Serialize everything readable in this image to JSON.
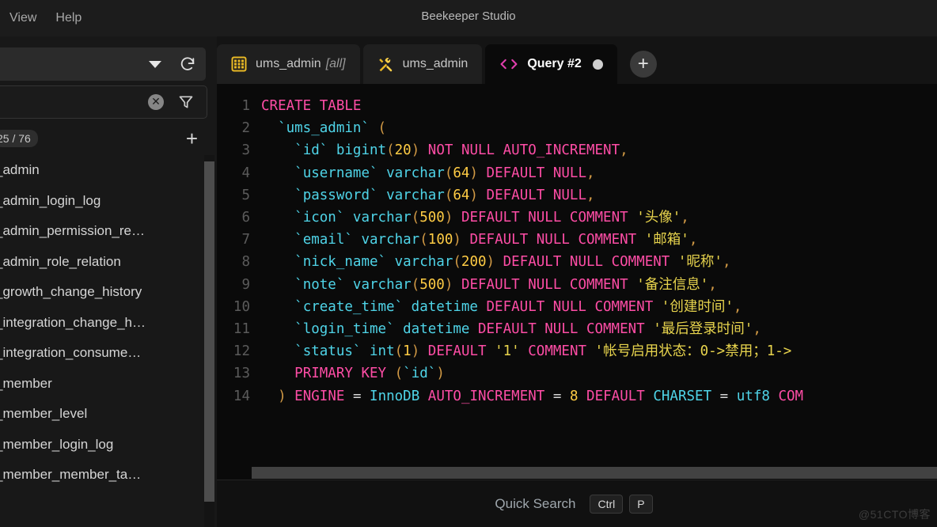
{
  "window": {
    "title": "Beekeeper Studio",
    "menus": [
      {
        "label": "View"
      },
      {
        "label": "Help"
      }
    ]
  },
  "sidebar": {
    "connection_dropdown": {
      "value": "",
      "caret_icon": "chevron-down-icon",
      "refresh_icon": "refresh-icon"
    },
    "filter_input": {
      "value": "",
      "placeholder": "",
      "clear_icon": "clear-circle-icon",
      "filter_icon": "funnel-icon"
    },
    "tables_count": "25 / 76",
    "add_label": "+",
    "tables": [
      {
        "label": "_admin"
      },
      {
        "label": "_admin_login_log"
      },
      {
        "label": "_admin_permission_re…"
      },
      {
        "label": "_admin_role_relation"
      },
      {
        "label": "_growth_change_history"
      },
      {
        "label": "_integration_change_h…"
      },
      {
        "label": "_integration_consume…"
      },
      {
        "label": "_member"
      },
      {
        "label": "_member_level"
      },
      {
        "label": "_member_login_log"
      },
      {
        "label": "_member_member_ta…"
      }
    ]
  },
  "tabs": [
    {
      "label": "ums_admin",
      "suffix": "[all]",
      "icon": "table-grid-icon",
      "active": false,
      "unsaved": false
    },
    {
      "label": "ums_admin",
      "suffix": "",
      "icon": "hammer-wrench-icon",
      "active": false,
      "unsaved": false
    },
    {
      "label": "Query #2",
      "suffix": "",
      "icon": "code-brackets-icon",
      "active": true,
      "unsaved": true
    }
  ],
  "add_tab_label": "+",
  "editor": {
    "lines": [
      {
        "n": "1",
        "tokens": [
          {
            "t": "CREATE TABLE",
            "c": "kw"
          }
        ]
      },
      {
        "n": "2",
        "tokens": [
          {
            "t": "  ",
            "c": "op"
          },
          {
            "t": "`ums_admin`",
            "c": "id"
          },
          {
            "t": " ",
            "c": "op"
          },
          {
            "t": "(",
            "c": "punc"
          }
        ]
      },
      {
        "n": "3",
        "tokens": [
          {
            "t": "    ",
            "c": "op"
          },
          {
            "t": "`id`",
            "c": "id"
          },
          {
            "t": " ",
            "c": "op"
          },
          {
            "t": "bigint",
            "c": "id"
          },
          {
            "t": "(",
            "c": "punc"
          },
          {
            "t": "20",
            "c": "num"
          },
          {
            "t": ")",
            "c": "punc"
          },
          {
            "t": " ",
            "c": "op"
          },
          {
            "t": "NOT NULL AUTO_INCREMENT",
            "c": "kw"
          },
          {
            "t": ",",
            "c": "punc"
          }
        ]
      },
      {
        "n": "4",
        "tokens": [
          {
            "t": "    ",
            "c": "op"
          },
          {
            "t": "`username`",
            "c": "id"
          },
          {
            "t": " ",
            "c": "op"
          },
          {
            "t": "varchar",
            "c": "id"
          },
          {
            "t": "(",
            "c": "punc"
          },
          {
            "t": "64",
            "c": "num"
          },
          {
            "t": ")",
            "c": "punc"
          },
          {
            "t": " ",
            "c": "op"
          },
          {
            "t": "DEFAULT NULL",
            "c": "kw"
          },
          {
            "t": ",",
            "c": "punc"
          }
        ]
      },
      {
        "n": "5",
        "tokens": [
          {
            "t": "    ",
            "c": "op"
          },
          {
            "t": "`password`",
            "c": "id"
          },
          {
            "t": " ",
            "c": "op"
          },
          {
            "t": "varchar",
            "c": "id"
          },
          {
            "t": "(",
            "c": "punc"
          },
          {
            "t": "64",
            "c": "num"
          },
          {
            "t": ")",
            "c": "punc"
          },
          {
            "t": " ",
            "c": "op"
          },
          {
            "t": "DEFAULT NULL",
            "c": "kw"
          },
          {
            "t": ",",
            "c": "punc"
          }
        ]
      },
      {
        "n": "6",
        "tokens": [
          {
            "t": "    ",
            "c": "op"
          },
          {
            "t": "`icon`",
            "c": "id"
          },
          {
            "t": " ",
            "c": "op"
          },
          {
            "t": "varchar",
            "c": "id"
          },
          {
            "t": "(",
            "c": "punc"
          },
          {
            "t": "500",
            "c": "num"
          },
          {
            "t": ")",
            "c": "punc"
          },
          {
            "t": " ",
            "c": "op"
          },
          {
            "t": "DEFAULT NULL COMMENT",
            "c": "kw"
          },
          {
            "t": " ",
            "c": "op"
          },
          {
            "t": "'头像'",
            "c": "str"
          },
          {
            "t": ",",
            "c": "punc"
          }
        ]
      },
      {
        "n": "7",
        "tokens": [
          {
            "t": "    ",
            "c": "op"
          },
          {
            "t": "`email`",
            "c": "id"
          },
          {
            "t": " ",
            "c": "op"
          },
          {
            "t": "varchar",
            "c": "id"
          },
          {
            "t": "(",
            "c": "punc"
          },
          {
            "t": "100",
            "c": "num"
          },
          {
            "t": ")",
            "c": "punc"
          },
          {
            "t": " ",
            "c": "op"
          },
          {
            "t": "DEFAULT NULL COMMENT",
            "c": "kw"
          },
          {
            "t": " ",
            "c": "op"
          },
          {
            "t": "'邮箱'",
            "c": "str"
          },
          {
            "t": ",",
            "c": "punc"
          }
        ]
      },
      {
        "n": "8",
        "tokens": [
          {
            "t": "    ",
            "c": "op"
          },
          {
            "t": "`nick_name`",
            "c": "id"
          },
          {
            "t": " ",
            "c": "op"
          },
          {
            "t": "varchar",
            "c": "id"
          },
          {
            "t": "(",
            "c": "punc"
          },
          {
            "t": "200",
            "c": "num"
          },
          {
            "t": ")",
            "c": "punc"
          },
          {
            "t": " ",
            "c": "op"
          },
          {
            "t": "DEFAULT NULL COMMENT",
            "c": "kw"
          },
          {
            "t": " ",
            "c": "op"
          },
          {
            "t": "'昵称'",
            "c": "str"
          },
          {
            "t": ",",
            "c": "punc"
          }
        ]
      },
      {
        "n": "9",
        "tokens": [
          {
            "t": "    ",
            "c": "op"
          },
          {
            "t": "`note`",
            "c": "id"
          },
          {
            "t": " ",
            "c": "op"
          },
          {
            "t": "varchar",
            "c": "id"
          },
          {
            "t": "(",
            "c": "punc"
          },
          {
            "t": "500",
            "c": "num"
          },
          {
            "t": ")",
            "c": "punc"
          },
          {
            "t": " ",
            "c": "op"
          },
          {
            "t": "DEFAULT NULL COMMENT",
            "c": "kw"
          },
          {
            "t": " ",
            "c": "op"
          },
          {
            "t": "'备注信息'",
            "c": "str"
          },
          {
            "t": ",",
            "c": "punc"
          }
        ]
      },
      {
        "n": "10",
        "tokens": [
          {
            "t": "    ",
            "c": "op"
          },
          {
            "t": "`create_time`",
            "c": "id"
          },
          {
            "t": " ",
            "c": "op"
          },
          {
            "t": "datetime",
            "c": "id"
          },
          {
            "t": " ",
            "c": "op"
          },
          {
            "t": "DEFAULT NULL COMMENT",
            "c": "kw"
          },
          {
            "t": " ",
            "c": "op"
          },
          {
            "t": "'创建时间'",
            "c": "str"
          },
          {
            "t": ",",
            "c": "punc"
          }
        ]
      },
      {
        "n": "11",
        "tokens": [
          {
            "t": "    ",
            "c": "op"
          },
          {
            "t": "`login_time`",
            "c": "id"
          },
          {
            "t": " ",
            "c": "op"
          },
          {
            "t": "datetime",
            "c": "id"
          },
          {
            "t": " ",
            "c": "op"
          },
          {
            "t": "DEFAULT NULL COMMENT",
            "c": "kw"
          },
          {
            "t": " ",
            "c": "op"
          },
          {
            "t": "'最后登录时间'",
            "c": "str"
          },
          {
            "t": ",",
            "c": "punc"
          }
        ]
      },
      {
        "n": "12",
        "tokens": [
          {
            "t": "    ",
            "c": "op"
          },
          {
            "t": "`status`",
            "c": "id"
          },
          {
            "t": " ",
            "c": "op"
          },
          {
            "t": "int",
            "c": "id"
          },
          {
            "t": "(",
            "c": "punc"
          },
          {
            "t": "1",
            "c": "num"
          },
          {
            "t": ")",
            "c": "punc"
          },
          {
            "t": " ",
            "c": "op"
          },
          {
            "t": "DEFAULT",
            "c": "kw"
          },
          {
            "t": " ",
            "c": "op"
          },
          {
            "t": "'1'",
            "c": "str"
          },
          {
            "t": " ",
            "c": "op"
          },
          {
            "t": "COMMENT",
            "c": "kw"
          },
          {
            "t": " ",
            "c": "op"
          },
          {
            "t": "'帐号启用状态：0->禁用；1->",
            "c": "str"
          }
        ]
      },
      {
        "n": "13",
        "tokens": [
          {
            "t": "    ",
            "c": "op"
          },
          {
            "t": "PRIMARY KEY",
            "c": "kw"
          },
          {
            "t": " ",
            "c": "op"
          },
          {
            "t": "(",
            "c": "punc"
          },
          {
            "t": "`id`",
            "c": "id"
          },
          {
            "t": ")",
            "c": "punc"
          }
        ]
      },
      {
        "n": "14",
        "tokens": [
          {
            "t": "  ",
            "c": "op"
          },
          {
            "t": ")",
            "c": "punc"
          },
          {
            "t": " ",
            "c": "op"
          },
          {
            "t": "ENGINE",
            "c": "kw"
          },
          {
            "t": " ",
            "c": "op"
          },
          {
            "t": "=",
            "c": "op"
          },
          {
            "t": " ",
            "c": "op"
          },
          {
            "t": "InnoDB",
            "c": "id"
          },
          {
            "t": " ",
            "c": "op"
          },
          {
            "t": "AUTO_INCREMENT",
            "c": "kw"
          },
          {
            "t": " ",
            "c": "op"
          },
          {
            "t": "=",
            "c": "op"
          },
          {
            "t": " ",
            "c": "op"
          },
          {
            "t": "8",
            "c": "num"
          },
          {
            "t": " ",
            "c": "op"
          },
          {
            "t": "DEFAULT",
            "c": "kw"
          },
          {
            "t": " ",
            "c": "op"
          },
          {
            "t": "CHARSET",
            "c": "id"
          },
          {
            "t": " ",
            "c": "op"
          },
          {
            "t": "=",
            "c": "op"
          },
          {
            "t": " ",
            "c": "op"
          },
          {
            "t": "utf8",
            "c": "id"
          },
          {
            "t": " ",
            "c": "op"
          },
          {
            "t": "COM",
            "c": "kw"
          }
        ]
      }
    ]
  },
  "statusbar": {
    "quick_search_label": "Quick Search",
    "shortcut_keys": [
      "Ctrl",
      "P"
    ]
  },
  "watermark": "@51CTO博客",
  "colors": {
    "accent_pink": "#ff4da6",
    "accent_cyan": "#4fd4e8",
    "accent_yellow": "#ffcc44",
    "string_yellow": "#e8d44d",
    "editor_bg": "#0a0a0a",
    "panel_bg": "#181818"
  }
}
